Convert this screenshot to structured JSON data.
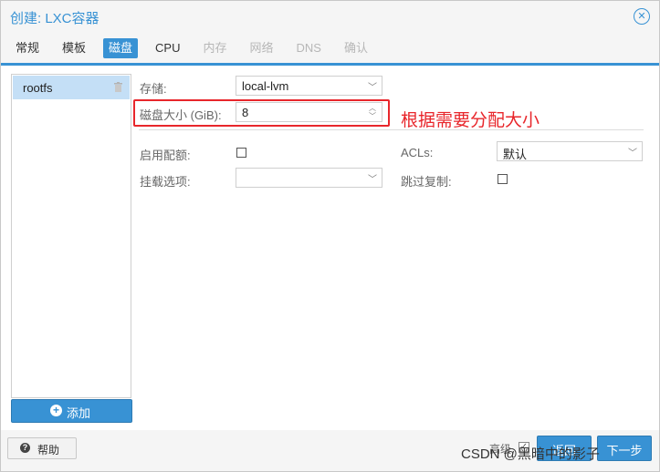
{
  "dialog": {
    "title": "创建: LXC容器",
    "close_icon": "close-circle-icon"
  },
  "tabs": [
    {
      "label": "常规",
      "state": "enabled"
    },
    {
      "label": "模板",
      "state": "enabled"
    },
    {
      "label": "磁盘",
      "state": "active"
    },
    {
      "label": "CPU",
      "state": "enabled"
    },
    {
      "label": "内存",
      "state": "disabled"
    },
    {
      "label": "网络",
      "state": "disabled"
    },
    {
      "label": "DNS",
      "state": "disabled"
    },
    {
      "label": "确认",
      "state": "disabled"
    }
  ],
  "disk_list": {
    "items": [
      {
        "label": "rootfs",
        "icon": "trash-icon"
      }
    ],
    "add_button": {
      "label": "添加",
      "icon": "plus-circle-icon"
    }
  },
  "form": {
    "storage": {
      "label": "存储:",
      "value": "local-lvm"
    },
    "disk_size": {
      "label": "磁盘大小 (GiB):",
      "value": "8"
    },
    "quota": {
      "label": "启用配额:",
      "checked": false
    },
    "mount_options": {
      "label": "挂载选项:",
      "value": ""
    },
    "acls": {
      "label": "ACLs:",
      "value": "默认"
    },
    "skip_replication": {
      "label": "跳过复制:",
      "checked": false
    }
  },
  "annotation": {
    "text": "根据需要分配大小",
    "color": "#e8262b"
  },
  "footer": {
    "help_label": "帮助",
    "advanced_label": "高级",
    "advanced_checked": true,
    "back_label": "返回",
    "next_label": "下一步"
  },
  "watermark": "CSDN @黑暗中的影子",
  "colors": {
    "accent": "#3892d4",
    "selected_row": "#c4dff6",
    "annotation_red": "#e8262b"
  }
}
